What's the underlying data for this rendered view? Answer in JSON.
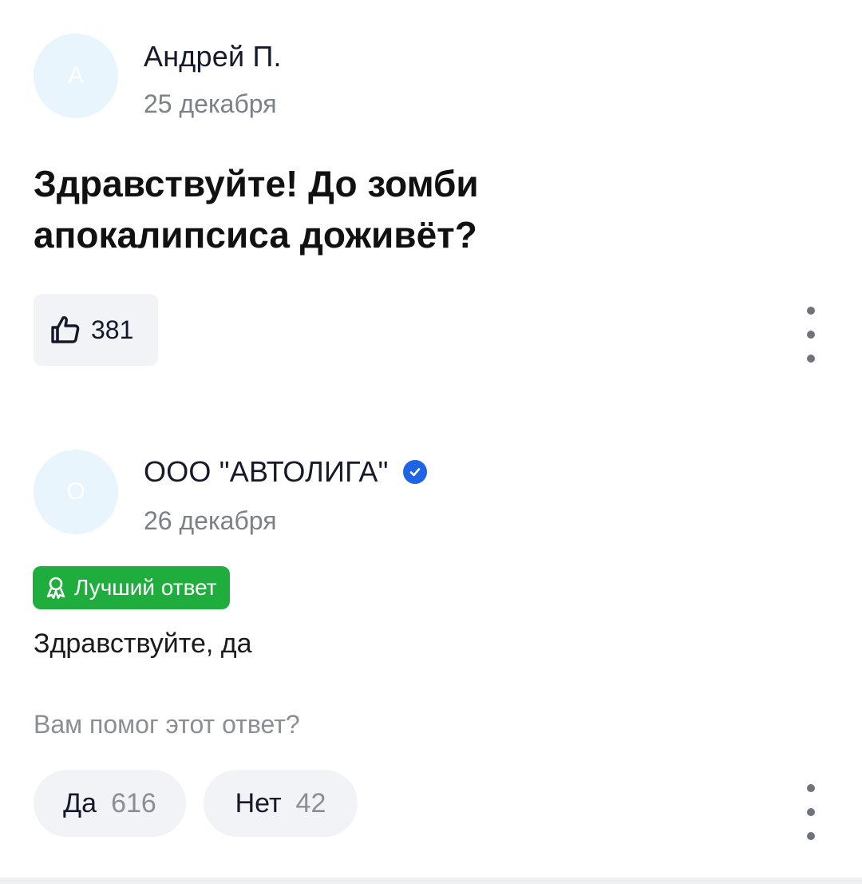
{
  "question_post": {
    "author": {
      "avatar_letter": "А",
      "name": "Андрей П.",
      "date": "25 декабря"
    },
    "text": "Здравствуйте! До зомби апокалипсиса доживёт?",
    "likes": "381"
  },
  "answer_post": {
    "author": {
      "avatar_letter": "О",
      "name": "ООО \"АВТОЛИГА\"",
      "verified": true,
      "date": "26 декабря"
    },
    "badge": "Лучший ответ",
    "text": "Здравствуйте, да",
    "helpful_prompt": "Вам помог этот ответ?",
    "votes": {
      "yes_label": "Да",
      "yes_count": "616",
      "no_label": "Нет",
      "no_count": "42"
    }
  },
  "colors": {
    "badge_green": "#1fad3e",
    "verified_blue": "#1f63e6",
    "avatar_bg": "#e9f5fc",
    "button_bg": "#f1f3f6"
  },
  "icons": [
    "thumbs-up-icon",
    "more-vertical-icon",
    "verified-check-icon",
    "award-icon"
  ]
}
